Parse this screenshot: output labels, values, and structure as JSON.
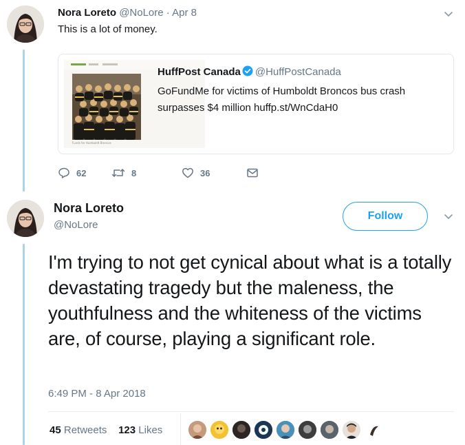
{
  "reply_tweet": {
    "author_name": "Nora Loreto",
    "author_handle": "@NoLore",
    "separator": "·",
    "date": "Apr 8",
    "text": "This is a lot of money.",
    "quoted": {
      "author_name": "HuffPost Canada",
      "author_handle": "@HuffPostCanada",
      "text": "GoFundMe for victims of Humboldt Broncos bus crash surpasses $4 million huffp.st/WnCdaH0",
      "image_caption": "Funds for Humboldt Broncos"
    },
    "actions": {
      "replies": "62",
      "retweets": "8",
      "likes": "36"
    }
  },
  "main_tweet": {
    "author_name": "Nora Loreto",
    "author_handle": "@NoLore",
    "follow_label": "Follow",
    "text": "I'm trying to not get cynical about what is a totally devastating tragedy but the maleness, the youthfulness and the whiteness of the victims are, of course, playing a significant role.",
    "timestamp": "6:49 PM - 8 Apr 2018",
    "retweet_count": "45",
    "retweet_label": "Retweets",
    "like_count": "123",
    "like_label": "Likes"
  },
  "colors": {
    "accent": "#1da1f2",
    "thread_line": "#a9d3ee",
    "secondary_text": "#657786"
  },
  "icons": [
    "reply-icon",
    "retweet-icon",
    "like-icon",
    "direct-message-icon",
    "chevron-down-icon",
    "verified-badge-icon"
  ]
}
